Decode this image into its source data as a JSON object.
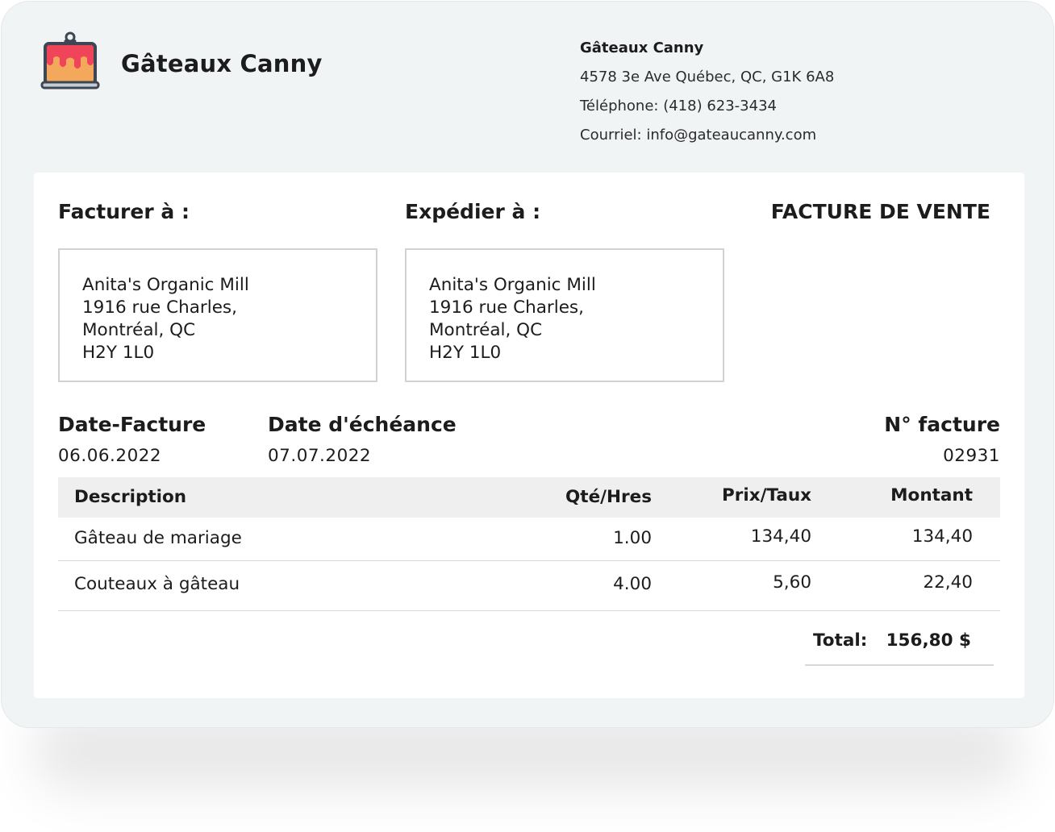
{
  "brand": {
    "logo_icon": "cake-icon",
    "title": "Gâteaux Canny",
    "accent_color": "#f0445a",
    "cake_color": "#f3a85c",
    "outline_color": "#3e4653"
  },
  "company": {
    "name": "Gâteaux Canny",
    "address": "4578 3e Ave Québec, QC, G1K 6A8",
    "phone": "Téléphone: (418) 623-3434",
    "email": "Courriel: info@gateaucanny.com"
  },
  "invoice": {
    "bill_to_label": "Facturer à :",
    "ship_to_label": "Expédier à :",
    "doc_title": "FACTURE DE VENTE",
    "bill_to": {
      "line1": "Anita's Organic Mill",
      "line2": "1916 rue Charles,",
      "line3": "Montréal, QC",
      "line4": "H2Y 1L0"
    },
    "ship_to": {
      "line1": "Anita's Organic Mill",
      "line2": "1916 rue Charles,",
      "line3": "Montréal, QC",
      "line4": "H2Y 1L0"
    },
    "date_label": "Date-Facture",
    "date_value": "06.06.2022",
    "due_label": "Date d'échéance",
    "due_value": "07.07.2022",
    "number_label": "N° facture",
    "number_value": "02931"
  },
  "table": {
    "headers": {
      "description": "Description",
      "qty": "Qté/Hres",
      "price": "Prix/Taux",
      "amount": "Montant"
    },
    "rows": [
      {
        "description": "Gâteau de mariage",
        "qty": "1.00",
        "price": "134,40",
        "amount": "134,40"
      },
      {
        "description": "Couteaux à gâteau",
        "qty": "4.00",
        "price": "5,60",
        "amount": "22,40"
      }
    ],
    "total_label": "Total:",
    "total_value": "156,80 $"
  }
}
